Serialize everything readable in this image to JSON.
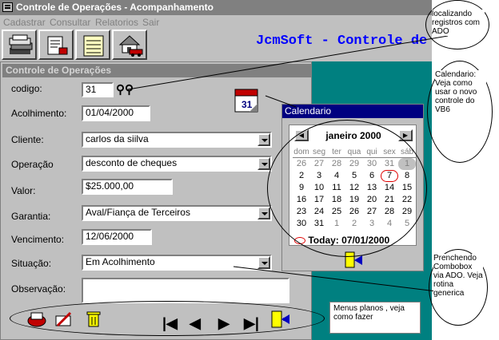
{
  "window": {
    "title": "Controle de Operações - Acompanhamento"
  },
  "menu": [
    {
      "label": "Cadastrar"
    },
    {
      "label": "Consultar"
    },
    {
      "label": "Relatorios"
    },
    {
      "label": "Sair"
    }
  ],
  "toolbar": {
    "buttons": [
      {
        "icon": "stack-icon"
      },
      {
        "icon": "document-stamp-icon"
      },
      {
        "icon": "notepad-icon"
      },
      {
        "icon": "house-car-icon"
      }
    ]
  },
  "brand": "JcmSoft - Controle de",
  "form": {
    "title": "Controle de Operações",
    "codigo": {
      "label": "codigo:",
      "value": "31"
    },
    "acolhimento": {
      "label": "Acolhimento:",
      "value": "01/04/2000"
    },
    "cliente": {
      "label": "Cliente:",
      "value": "carlos da siilva"
    },
    "operacao": {
      "label": "Operação",
      "value": "desconto de cheques"
    },
    "valor": {
      "label": "Valor:",
      "value": "$25.000,00"
    },
    "garantia": {
      "label": "Garantia:",
      "value": "Aval/Fiança de Terceiros"
    },
    "vencimento": {
      "label": "Vencimento:",
      "value": "12/06/2000"
    },
    "situacao": {
      "label": "Situação:",
      "value": "Em Acolhimento"
    },
    "observacao": {
      "label": "Observação:",
      "value": ""
    }
  },
  "calendar": {
    "title": "Calendario",
    "month": "janeiro 2000",
    "weekdays": [
      "dom",
      "seg",
      "ter",
      "qua",
      "qui",
      "sex",
      "sáb"
    ],
    "weeks": [
      [
        "26",
        "27",
        "28",
        "29",
        "30",
        "31",
        "1"
      ],
      [
        "2",
        "3",
        "4",
        "5",
        "6",
        "7",
        "8"
      ],
      [
        "9",
        "10",
        "11",
        "12",
        "13",
        "14",
        "15"
      ],
      [
        "16",
        "17",
        "18",
        "19",
        "20",
        "21",
        "22"
      ],
      [
        "23",
        "24",
        "25",
        "26",
        "27",
        "28",
        "29"
      ],
      [
        "30",
        "31",
        "1",
        "2",
        "3",
        "4",
        "5"
      ]
    ],
    "today_label": "Today: 07/01/2000"
  },
  "notes": {
    "localizando": "localizando registros com ADO",
    "calendario": "Calendario: Veja como usar o novo controle do VB6",
    "combobox": "Prenchendo Combobox via ADO. Veja rotina generica",
    "menus": "Menus planos , veja como fazer"
  },
  "colors": {
    "titlebar": "#808080",
    "calendar_title": "#000080",
    "brand": "#0000ff",
    "desktop": "#008080"
  }
}
